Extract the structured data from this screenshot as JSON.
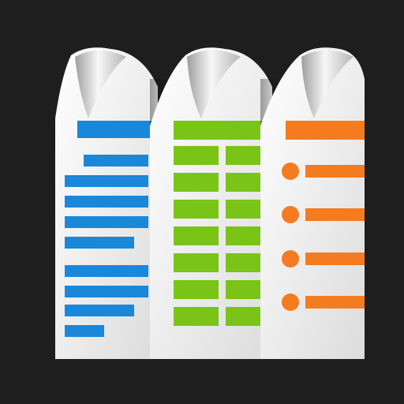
{
  "app_icon": {
    "name": "documents-suite-icon",
    "background": "#1e1e1e",
    "pages": [
      {
        "kind": "text-document",
        "accent": "#1b87d8",
        "accent_light": "#3aa8ee"
      },
      {
        "kind": "spreadsheet",
        "accent": "#7ac417",
        "accent_light": "#98d92a"
      },
      {
        "kind": "presentation",
        "accent": "#f47b20",
        "accent_light": "#ff9a3c"
      }
    ],
    "paper_colors": [
      "#f4f4f4",
      "#d9d9d9",
      "#bfbfbf"
    ]
  }
}
